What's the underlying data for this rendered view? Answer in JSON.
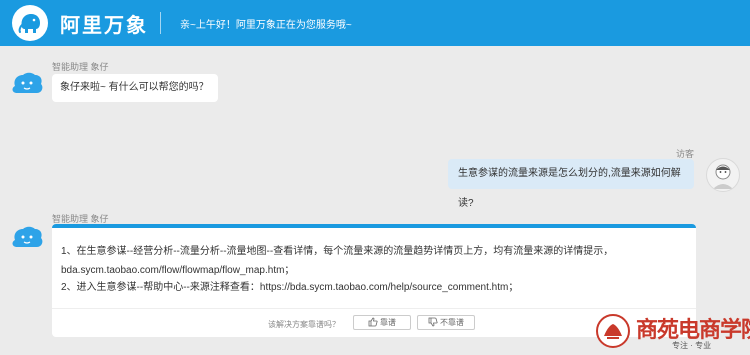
{
  "header": {
    "logo_text": "阿里万象",
    "greeting": "亲~上午好！阿里万象正在为您服务哦~"
  },
  "messages": [
    {
      "sender": "智能助理 象仔",
      "text": "象仔来啦~ 有什么可以帮您的吗？"
    },
    {
      "sender": "访客",
      "text": "生意参谋的流量来源是怎么划分的,流量来源如何解读?"
    },
    {
      "sender": "智能助理 象仔",
      "lines": [
        "1、在生意参谋--经营分析--流量分析--流量地图--查看详情，每个流量来源的流量趋势详情页上方，均有流量来源的详情提示，",
        "bda.sycm.taobao.com/flow/flowmap/flow_map.htm；",
        "2、进入生意参谋--帮助中心--来源注释查看：https://bda.sycm.taobao.com/help/source_comment.htm；"
      ],
      "feedback": {
        "question": "该解决方案靠谱吗？",
        "like": "靠谱",
        "dislike": "不靠谱"
      }
    }
  ],
  "watermark": {
    "title": "商苑电商学院",
    "subtitle": "专注 · 专业"
  },
  "colors": {
    "brand_blue": "#1a9ae0",
    "user_bubble": "#daeaf7",
    "watermark_red": "#c9392b"
  },
  "icons": [
    "elephant-logo-icon",
    "bot-avatar-icon",
    "user-avatar-icon",
    "thumbs-up-icon",
    "thumbs-down-icon",
    "watermark-seal-icon"
  ]
}
